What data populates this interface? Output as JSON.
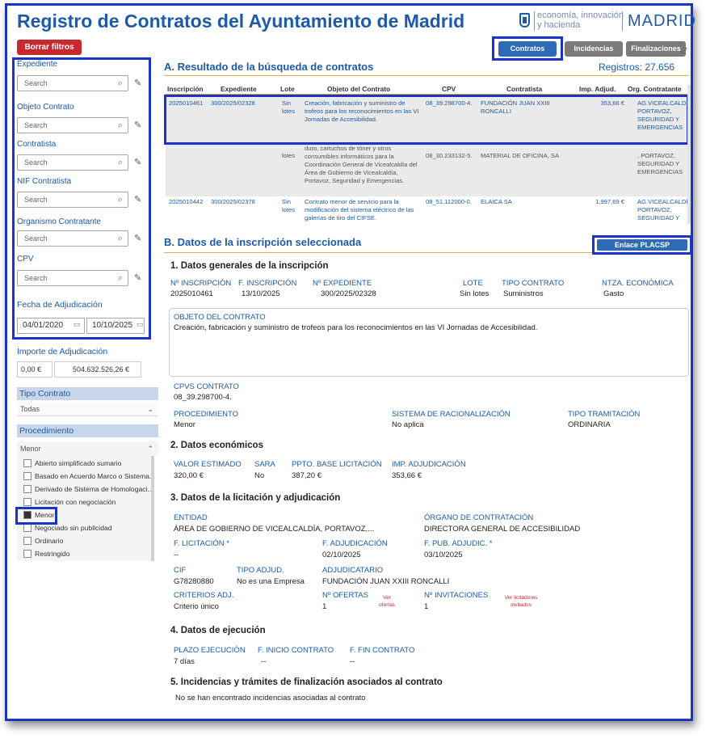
{
  "app": {
    "title": "Registro de Contratos del Ayuntamiento de Madrid",
    "logo_line1": "economía, innovación",
    "logo_line2": "y hacienda",
    "logo_brand": "MADRID"
  },
  "toolbar": {
    "clear_filters": "Borrar filtros",
    "tabs": [
      "Contratos",
      "Incidencias",
      "Finalizaciones"
    ]
  },
  "filters": {
    "expediente_label": "Expediente",
    "objeto_label": "Objeto Contrato",
    "contratista_label": "Contratista",
    "nif_label": "NIF Contratista",
    "organismo_label": "Organismo Contratante",
    "cpv_label": "CPV",
    "search_placeholder": "Search",
    "fecha_label": "Fecha de Adjudicación",
    "fecha_from": "04/01/2020",
    "fecha_to": "10/10/2025",
    "importe_label": "Importe de Adjudicación",
    "importe_min": "0,00 €",
    "importe_max": "504.632.526,26 €",
    "tipo_label": "Tipo Contrato",
    "tipo_value": "Todas",
    "proc_label": "Procedimiento",
    "proc_value": "Menor",
    "proc_options": [
      {
        "label": "Abierto simplificado sumario",
        "checked": false
      },
      {
        "label": "Basado en Acuerdo Marco o Sistema...",
        "checked": false
      },
      {
        "label": "Derivado de Sistema de Homologaci...",
        "checked": false
      },
      {
        "label": "Licitación con negociación",
        "checked": false
      },
      {
        "label": "Menor",
        "checked": true
      },
      {
        "label": "Negociado sin publicidad",
        "checked": false
      },
      {
        "label": "Ordinario",
        "checked": false
      },
      {
        "label": "Restringido",
        "checked": false
      }
    ]
  },
  "results": {
    "heading": "A. Resultado de la búsqueda de contratos",
    "registros": "Registros: 27.656",
    "columns": [
      "Inscripción",
      "Expediente",
      "Lote",
      "Objeto del Contrato",
      "CPV",
      "Contratista",
      "Imp. Adjud.",
      "Org. Contratante"
    ],
    "rows": [
      {
        "inscripcion": "2025010461",
        "expediente": "300/2025/02328",
        "lote": "Sin lotes",
        "objeto": "Creación, fabricación y suministro de trofeos para los reconocimientos en las VI Jornadas de Accesibilidad.",
        "cpv": "08_39.298700-4.",
        "contratista": "FUNDACIÓN JUAN XXIII RONCALLI",
        "importe": "353,66 €",
        "org": "AG.VICEALCALDÍA, PORTAVOZ, SEGURIDAD Y EMERGENCIAS"
      },
      {
        "inscripcion": "",
        "expediente": "",
        "lote": "lotes",
        "objeto": "duro, cartuchos de tóner y otros consumibles informáticos para la Coordinación General de Vicealcaldía del Área de Gobierno de Vicealcaldía, Portavoz, Seguridad y Emergencias.",
        "cpv": "08_30.233132-5.",
        "contratista": "MATERIAL DE OFICINA, SA",
        "importe": "",
        "org": ", PORTAVOZ, SEGURIDAD Y EMERGENCIAS"
      },
      {
        "inscripcion": "2025010442",
        "expediente": "300/2025/02378",
        "lote": "Sin lotes",
        "objeto": "Contrato menor de servicio para la modificación del sistema eléctrico de las galerías de tiro del CIFSE.",
        "cpv": "08_51.112000-0.",
        "contratista": "ELAICA SA",
        "importe": "1.997,69 €",
        "org": "AG.VICEALCALDÍA, PORTAVOZ, SEGURIDAD Y"
      }
    ]
  },
  "detail": {
    "heading": "B. Datos de la inscripción seleccionada",
    "placsp": "Enlace PLACSP",
    "s1": {
      "title": "1. Datos generales de la inscripción",
      "ninsc_l": "Nº INSCRIPCIÓN",
      "ninsc_v": "2025010461",
      "finsc_l": "F. INSCRIPCIÓN",
      "finsc_v": "13/10/2025",
      "nexp_l": "Nº EXPEDIENTE",
      "nexp_v": "300/2025/02328",
      "lote_l": "LOTE",
      "lote_v": "Sin lotes",
      "tipo_l": "TIPO CONTRATO",
      "tipo_v": "Suministros",
      "ntza_l": "NTZA. ECONÓMICA",
      "ntza_v": "Gasto",
      "objeto_l": "OBJETO DEL CONTRATO",
      "objeto_v": "Creación, fabricación y suministro de trofeos para los reconocimientos en las VI Jornadas de Accesibilidad.",
      "cpvs_l": "CPVS CONTRATO",
      "cpvs_v": "08_39.298700-4.",
      "proc_l": "PROCEDIMIENTO",
      "proc_v": "Menor",
      "sist_l": "SISTEMA DE RACIONALIZACIÓN",
      "sist_v": "No aplica",
      "tram_l": "TIPO TRAMITACIÓN",
      "tram_v": "ORDINARIA"
    },
    "s2": {
      "title": "2. Datos económicos",
      "valor_l": "VALOR ESTIMADO",
      "valor_v": "320,00 €",
      "sara_l": "SARA",
      "sara_v": "No",
      "ppto_l": "PPTO. BASE LICITACIÓN",
      "ppto_v": "387,20 €",
      "imp_l": "IMP. ADJUDICACIÓN",
      "imp_v": "353,66 €"
    },
    "s3": {
      "title": "3. Datos de la licitación y adjudicación",
      "entidad_l": "ENTIDAD",
      "entidad_v": "ÁREA DE GOBIERNO DE VICEALCALDÍA, PORTAVOZ,...",
      "organo_l": "ÓRGANO DE CONTRATACIÓN",
      "organo_v": "DIRECTORA GENERAL DE ACCESIBILIDAD",
      "flic_l": "F. LICITACIÓN *",
      "flic_v": "--",
      "fadj_l": "F. ADJUDICACIÓN",
      "fadj_v": "02/10/2025",
      "fpub_l": "F. PUB. ADJUDIC. *",
      "fpub_v": "03/10/2025",
      "cif_l": "CIF",
      "cif_v": "G78280880",
      "tadj_l": "TIPO ADJUD.",
      "tadj_v": "No es una Empresa",
      "adjud_l": "ADJUDICATARIO",
      "adjud_v": "FUNDACIÓN JUAN XXIII RONCALLI",
      "crit_l": "CRITERIOS ADJ.",
      "crit_v": "Criterio único",
      "nofer_l": "Nº OFERTAS",
      "nofer_v": "1",
      "ver_ofertas": "Ver ofertas",
      "ninv_l": "Nº INVITACIONES",
      "ninv_v": "1",
      "ver_licit": "Ver licitadores invitados"
    },
    "s4": {
      "title": "4. Datos de ejecución",
      "plazo_l": "PLAZO EJECUCIÓN",
      "plazo_v": "7 días",
      "fini_l": "F. INICIO CONTRATO",
      "fini_v": "--",
      "ffin_l": "F. FIN CONTRATO",
      "ffin_v": "--"
    },
    "s5": {
      "title": "5. Incidencias y trámites de finalización asociados al contrato",
      "text": "No se han encontrado incidencias asociadas al contrato"
    }
  },
  "colors": {
    "brand_blue": "#1d5aa8",
    "highlight_border": "#1a33c8",
    "clear_red": "#c8282e",
    "tab_active": "#2d6cb5",
    "tab_inactive": "#7a7a7a"
  }
}
